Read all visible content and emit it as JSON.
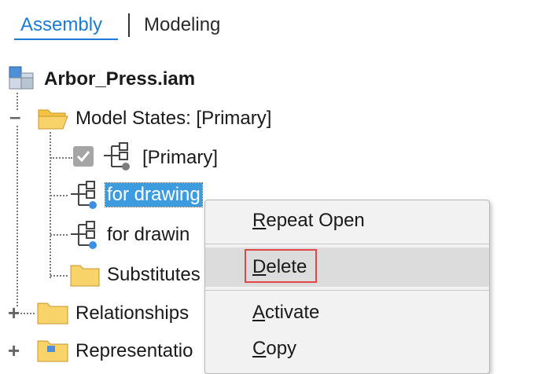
{
  "tabs": {
    "assembly": "Assembly",
    "modeling": "Modeling"
  },
  "tree": {
    "root": "Arbor_Press.iam",
    "model_states": "Model States: [Primary]",
    "primary": "[Primary]",
    "item_selected": "for drawing",
    "item_second": "for drawin",
    "substitutes": "Substitutes",
    "relationships": "Relationships",
    "representations": "Representatio"
  },
  "context_menu": {
    "repeat_open": {
      "accel": "R",
      "rest": "epeat Open"
    },
    "delete": {
      "accel": "D",
      "rest": "elete"
    },
    "activate": {
      "accel": "A",
      "rest": "ctivate"
    },
    "copy": {
      "accel": "C",
      "rest": "opy"
    }
  },
  "colors": {
    "accent": "#1c7bd6",
    "selection": "#3d9be0",
    "highlight_box": "#e04848",
    "folder": "#f5c242"
  }
}
